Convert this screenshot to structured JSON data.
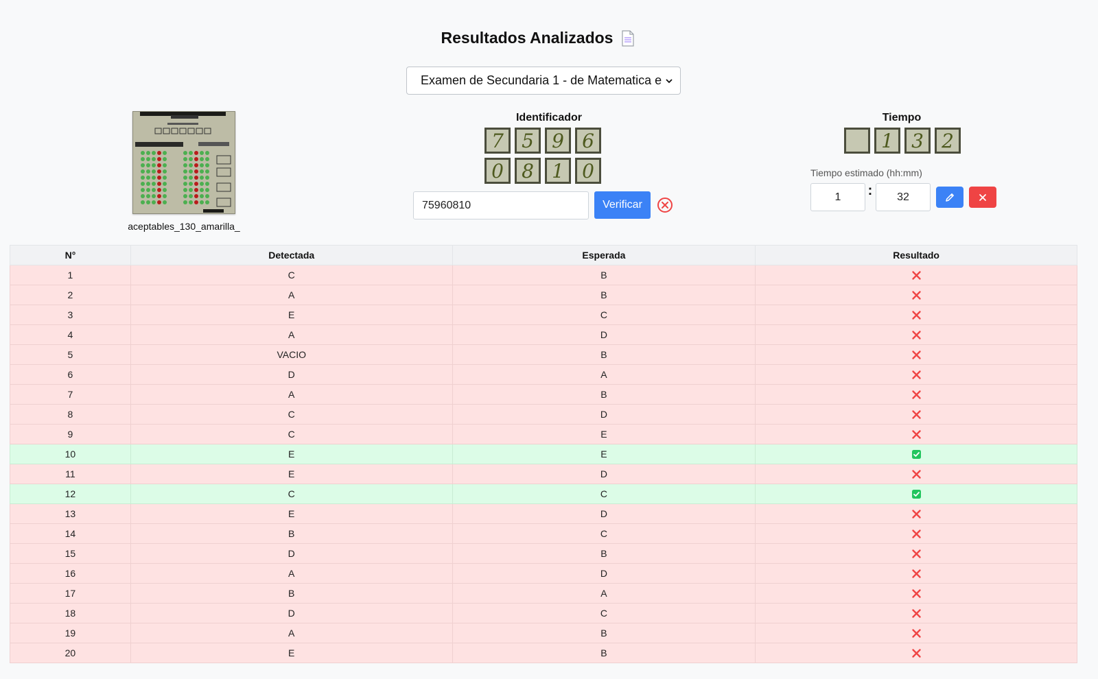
{
  "header": {
    "title": "Resultados Analizados",
    "icon": "document-icon"
  },
  "exam_select": {
    "selected": "Examen de Secundaria 1 - de Matematica e"
  },
  "sheet": {
    "filename": "aceptables_130_amarilla_"
  },
  "identifier": {
    "label": "Identificador",
    "digits": [
      "7",
      "5",
      "9",
      "6",
      "0",
      "8",
      "1",
      "0"
    ],
    "input_value": "75960810",
    "verify_label": "Verificar"
  },
  "time": {
    "label": "Tiempo",
    "digits": [
      "",
      "1",
      "3",
      "2"
    ],
    "estimated_label": "Tiempo estimado (hh:mm)",
    "hours": "1",
    "minutes": "32"
  },
  "colors": {
    "wrong_row": "#fee2e2",
    "right_row": "#dcfce7",
    "primary": "#3b82f6",
    "danger": "#ef4444"
  },
  "table": {
    "headers": [
      "N°",
      "Detectada",
      "Esperada",
      "Resultado"
    ],
    "rows": [
      {
        "n": "1",
        "detected": "C",
        "expected": "B",
        "correct": false
      },
      {
        "n": "2",
        "detected": "A",
        "expected": "B",
        "correct": false
      },
      {
        "n": "3",
        "detected": "E",
        "expected": "C",
        "correct": false
      },
      {
        "n": "4",
        "detected": "A",
        "expected": "D",
        "correct": false
      },
      {
        "n": "5",
        "detected": "VACIO",
        "expected": "B",
        "correct": false
      },
      {
        "n": "6",
        "detected": "D",
        "expected": "A",
        "correct": false
      },
      {
        "n": "7",
        "detected": "A",
        "expected": "B",
        "correct": false
      },
      {
        "n": "8",
        "detected": "C",
        "expected": "D",
        "correct": false
      },
      {
        "n": "9",
        "detected": "C",
        "expected": "E",
        "correct": false
      },
      {
        "n": "10",
        "detected": "E",
        "expected": "E",
        "correct": true
      },
      {
        "n": "11",
        "detected": "E",
        "expected": "D",
        "correct": false
      },
      {
        "n": "12",
        "detected": "C",
        "expected": "C",
        "correct": true
      },
      {
        "n": "13",
        "detected": "E",
        "expected": "D",
        "correct": false
      },
      {
        "n": "14",
        "detected": "B",
        "expected": "C",
        "correct": false
      },
      {
        "n": "15",
        "detected": "D",
        "expected": "B",
        "correct": false
      },
      {
        "n": "16",
        "detected": "A",
        "expected": "D",
        "correct": false
      },
      {
        "n": "17",
        "detected": "B",
        "expected": "A",
        "correct": false
      },
      {
        "n": "18",
        "detected": "D",
        "expected": "C",
        "correct": false
      },
      {
        "n": "19",
        "detected": "A",
        "expected": "B",
        "correct": false
      },
      {
        "n": "20",
        "detected": "E",
        "expected": "B",
        "correct": false
      }
    ]
  }
}
